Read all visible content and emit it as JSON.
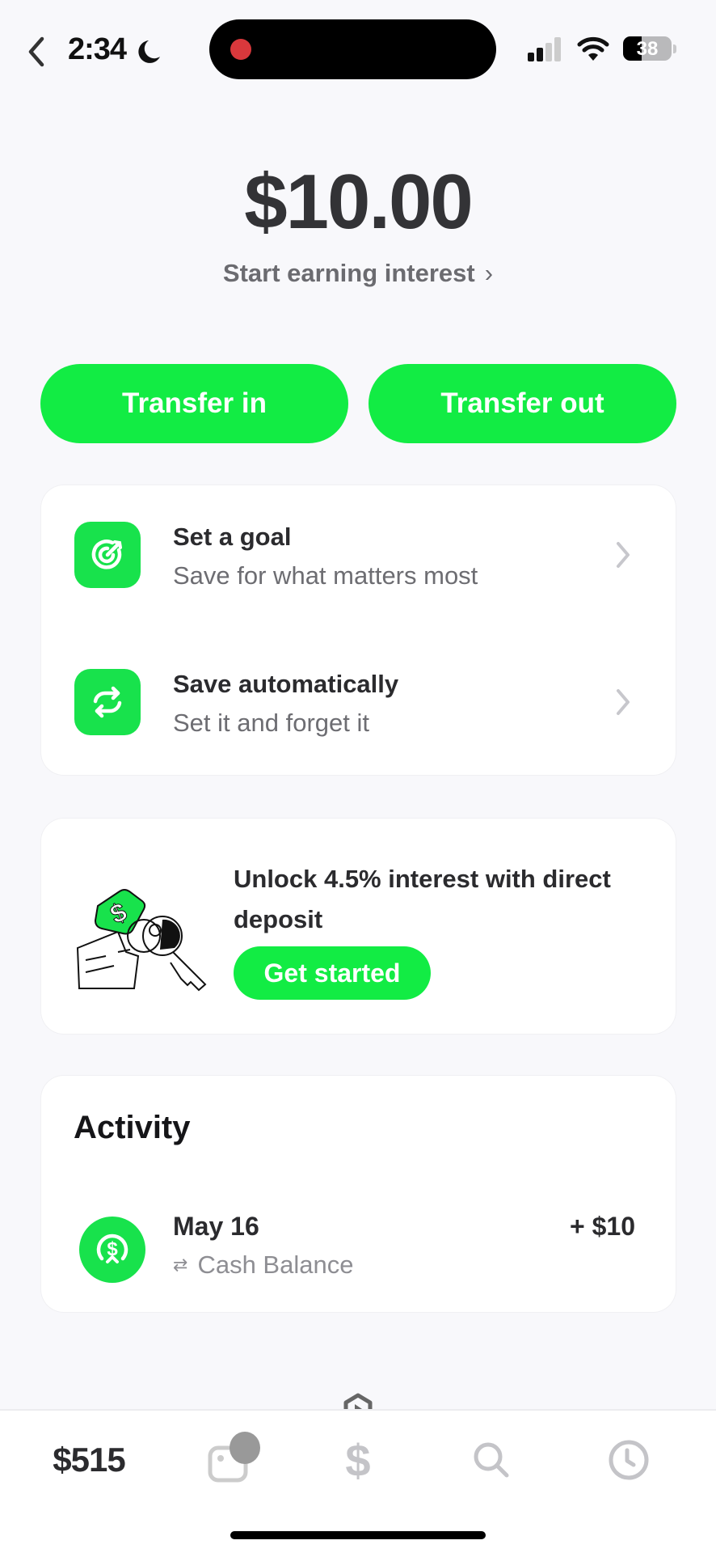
{
  "status_bar": {
    "time": "2:34",
    "battery_level": "38",
    "battery_fraction": 0.38,
    "signal_bars_active": 2,
    "signal_bars_total": 4,
    "icons": [
      "back-chevron-icon",
      "moon-icon",
      "recording-dot-icon",
      "signal-icon",
      "wifi-icon",
      "battery-icon"
    ]
  },
  "header": {
    "balance": "$10.00",
    "earn_link": "Start earning interest",
    "earn_chevron": "›"
  },
  "actions": {
    "transfer_in": "Transfer in",
    "transfer_out": "Transfer out"
  },
  "features": [
    {
      "icon": "target-goal-icon",
      "title": "Set a goal",
      "subtitle": "Save for what matters most"
    },
    {
      "icon": "repeat-arrows-icon",
      "title": "Save automatically",
      "subtitle": "Set it and forget it"
    }
  ],
  "promo": {
    "illustration": "dollar-tag-check-key-illustration",
    "text": "Unlock 4.5% interest with direct deposit",
    "button": "Get started"
  },
  "activity": {
    "title": "Activity",
    "items": [
      {
        "icon": "cash-dollar-icon",
        "date": "May 16",
        "source_icon": "swap-arrows-icon",
        "source": "Cash Balance",
        "amount": "+ $10"
      }
    ]
  },
  "tabbar": {
    "money_label": "$515",
    "tabs": [
      "money-tab",
      "card-tab",
      "pay-tab",
      "search-tab",
      "activity-tab"
    ]
  },
  "colors": {
    "brand_green": "#12ec44",
    "background": "#f8f8fb",
    "text_primary": "#333336",
    "text_secondary": "#6d6d72"
  }
}
